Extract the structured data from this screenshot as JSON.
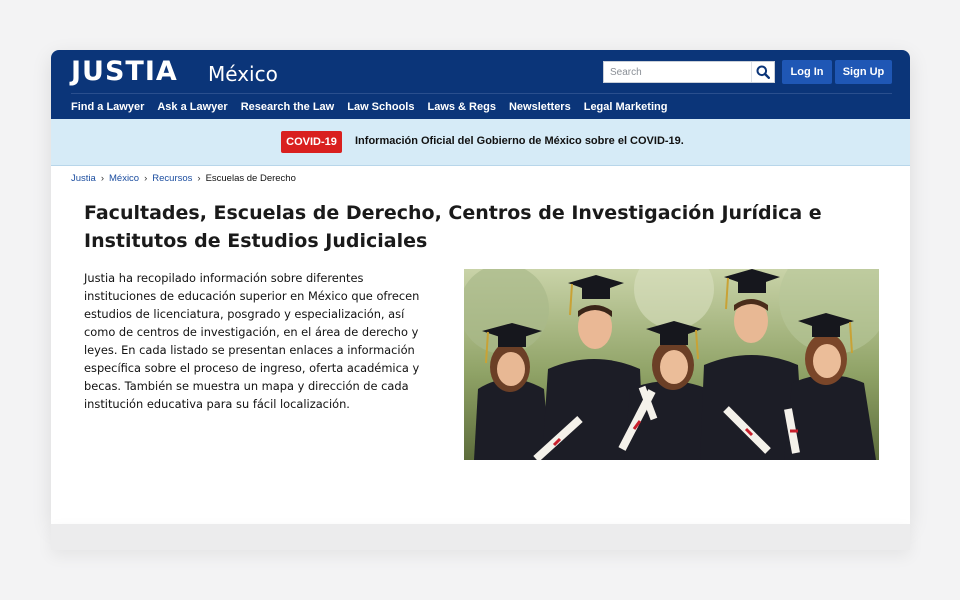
{
  "header": {
    "brand": "JUSTIA",
    "region": "México",
    "search": {
      "placeholder": "Search",
      "value": ""
    },
    "login_label": "Log In",
    "signup_label": "Sign Up",
    "nav": [
      "Find a Lawyer",
      "Ask a Lawyer",
      "Research the Law",
      "Law Schools",
      "Laws & Regs",
      "Newsletters",
      "Legal Marketing"
    ]
  },
  "alert": {
    "badge": "COVID-19",
    "text": "Información Oficial del Gobierno de México sobre el COVID-19."
  },
  "breadcrumb": {
    "items": [
      "Justia",
      "México",
      "Recursos"
    ],
    "current": "Escuelas de Derecho"
  },
  "main": {
    "title": "Facultades, Escuelas de Derecho, Centros de Investigación Jurídica e Institutos de Estudios Judiciales",
    "intro": "Justia ha recopilado información sobre diferentes instituciones de educación superior en México que ofrecen estudios de licenciatura, posgrado y especialización, así como de centros de investigación, en el área de derecho y leyes. En cada listado se presentan enlaces a información específica sobre el proceso de ingreso, oferta académica y becas. También se muestra un mapa y dirección de cada institución educativa para su fácil localización."
  },
  "colors": {
    "header_bg": "#0b3579",
    "button_bg": "#1f57b5",
    "alert_bg": "#d6ebf7",
    "badge_bg": "#d9201f",
    "link": "#1c4ea0"
  },
  "icons": {
    "search": "search-icon"
  }
}
